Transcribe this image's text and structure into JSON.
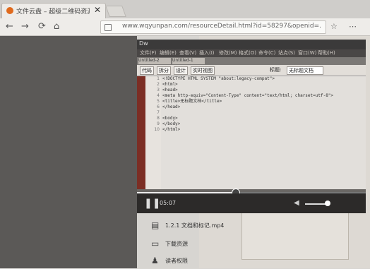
{
  "browser": {
    "tab_title": "文件云盘 – 超级二维码资源",
    "close_glyph": "✕",
    "url": "www.wqyunpan.com/resourceDetail.html?id=58297&openid=...",
    "nav": {
      "back": "←",
      "forward": "→",
      "reload": "⟳",
      "home": "⌂"
    },
    "right_icons": {
      "star": "☆",
      "menu": "⋯"
    }
  },
  "editor": {
    "app_name": "Dw",
    "menu_items": [
      "文件(F)",
      "编辑(E)",
      "查看(V)",
      "插入(I)",
      "修改(M)",
      "格式(O)",
      "命令(C)",
      "站点(S)",
      "窗口(W)",
      "帮助(H)"
    ],
    "doc_tabs": [
      "Untitled-2",
      "Untitled-1"
    ],
    "toolbar": [
      "代码",
      "拆分",
      "设计",
      "实时视图",
      "标题:",
      "无标题文档"
    ],
    "line_numbers": [
      "1",
      "2",
      "3",
      "4",
      "5",
      "6",
      "7",
      "8",
      "9",
      "10"
    ],
    "code_lines": [
      "<!DOCTYPE HTML SYSTEM \"about:legacy-compat\">",
      "<html>",
      "<head>",
      "<meta http-equiv=\"Content-Type\" content=\"text/html; charset=utf-8\">",
      "<title>无标题文档</title>",
      "</head>",
      "",
      "<body>",
      "</body>",
      "</html>"
    ]
  },
  "player": {
    "time": "05:07",
    "progress": 0.43,
    "volume": 0.9,
    "pause_glyph": "❚❚"
  },
  "file_list": [
    {
      "icon": "video-file-icon",
      "label": "1.2.1 文档和标记.mp4"
    },
    {
      "icon": "download-icon",
      "label": "下载资源"
    },
    {
      "icon": "user-icon",
      "label": "读者权限"
    }
  ]
}
